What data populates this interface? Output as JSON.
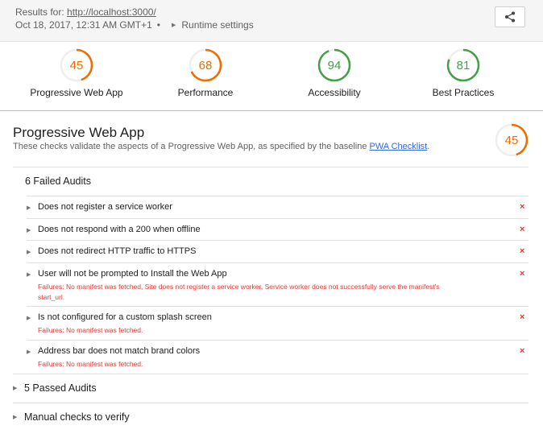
{
  "header": {
    "results_label": "Results for:",
    "url": "http://localhost:3000/",
    "timestamp": "Oct 18, 2017, 12:31 AM GMT+1",
    "separator": "•",
    "runtime_label": "Runtime settings",
    "share_icon": "share-icon"
  },
  "gauges": [
    {
      "label": "Progressive Web App",
      "score": "45",
      "value": 45,
      "color": "#ef6c00"
    },
    {
      "label": "Performance",
      "score": "68",
      "value": 68,
      "color": "#ef6c00"
    },
    {
      "label": "Accessibility",
      "score": "94",
      "value": 94,
      "color": "#43a047"
    },
    {
      "label": "Best Practices",
      "score": "81",
      "value": 81,
      "color": "#43a047"
    }
  ],
  "category": {
    "title": "Progressive Web App",
    "description": "These checks validate the aspects of a Progressive Web App, as specified by the baseline",
    "link_text": "PWA Checklist",
    "link_suffix": ".",
    "score": "45",
    "value": 45,
    "color": "#ef6c00"
  },
  "failed_group": {
    "title": "6 Failed Audits",
    "audits": [
      {
        "title": "Does not register a service worker",
        "details": ""
      },
      {
        "title": "Does not respond with a 200 when offline",
        "details": ""
      },
      {
        "title": "Does not redirect HTTP traffic to HTTPS",
        "details": ""
      },
      {
        "title": "User will not be prompted to Install the Web App",
        "details": "Failures: No manifest was fetched, Site does not register a service worker, Service worker does not successfully serve the manifest's start_url."
      },
      {
        "title": "Is not configured for a custom splash screen",
        "details": "Failures: No manifest was fetched."
      },
      {
        "title": "Address bar does not match brand colors",
        "details": "Failures: No manifest was fetched."
      }
    ],
    "fail_mark": "×"
  },
  "passed_group": {
    "title": "5 Passed Audits"
  },
  "manual_group": {
    "title": "Manual checks to verify"
  },
  "colors": {
    "fail": "#e53935",
    "average": "#ef6c00",
    "pass": "#43a047"
  }
}
